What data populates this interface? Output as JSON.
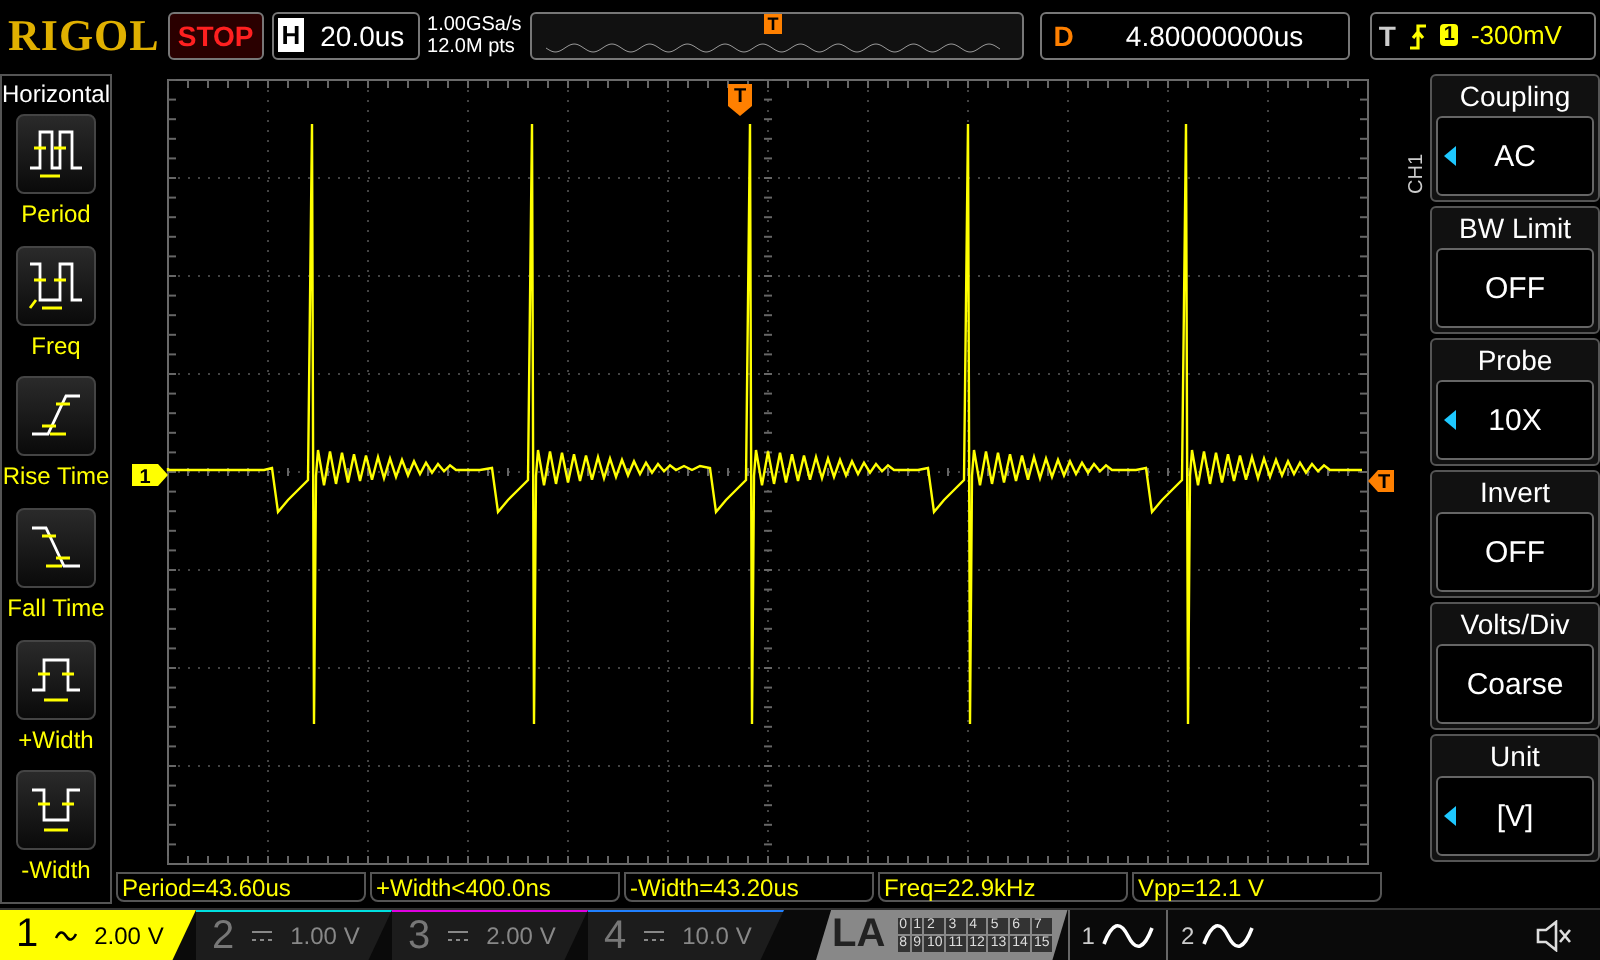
{
  "top_bar": {
    "brand": "RIGOL",
    "run_state": "STOP",
    "horizontal": {
      "label": "H",
      "value": "20.0us"
    },
    "sample_rate": "1.00GSa/s",
    "memory_depth": "12.0M pts",
    "overview_marker": "T",
    "delay": {
      "label": "D",
      "value": "4.80000000us"
    },
    "trigger": {
      "label": "T",
      "source": "1",
      "level": "-300mV"
    }
  },
  "left_menu": {
    "title": "Horizontal",
    "items": [
      {
        "label": "Period",
        "kind": "period"
      },
      {
        "label": "Freq",
        "kind": "freq"
      },
      {
        "label": "Rise Time",
        "kind": "rise"
      },
      {
        "label": "Fall Time",
        "kind": "fall"
      },
      {
        "label": "+Width",
        "kind": "pwidth"
      },
      {
        "label": "-Width",
        "kind": "nwidth"
      }
    ]
  },
  "screen": {
    "channel_marker": "1",
    "trigger_position_marker": "T",
    "trigger_level_marker": "T"
  },
  "right_menu": {
    "channel": "CH1",
    "items": [
      {
        "title": "Coupling",
        "value": "AC",
        "adjustable": true
      },
      {
        "title": "BW Limit",
        "value": "OFF",
        "adjustable": false
      },
      {
        "title": "Probe",
        "value": "10X",
        "adjustable": true
      },
      {
        "title": "Invert",
        "value": "OFF",
        "adjustable": false
      },
      {
        "title": "Volts/Div",
        "value": "Coarse",
        "adjustable": false
      },
      {
        "title": "Unit",
        "value": "[V]",
        "adjustable": true
      }
    ]
  },
  "measurements": [
    "Period=43.60us",
    "+Width<400.0ns",
    "-Width=43.20us",
    "Freq=22.9kHz",
    "Vpp=12.1 V"
  ],
  "channels": [
    {
      "number": "1",
      "kind": "ac",
      "scale": "2.00 V",
      "active": true,
      "color": "#ffff00"
    },
    {
      "number": "2",
      "kind": "dc",
      "scale": "1.00 V",
      "active": false,
      "color": "#00e0e0"
    },
    {
      "number": "3",
      "kind": "dc",
      "scale": "2.00 V",
      "active": false,
      "color": "#e000e0"
    },
    {
      "number": "4",
      "kind": "dc",
      "scale": "10.0 V",
      "active": false,
      "color": "#2080ff"
    }
  ],
  "logic_analyzer": {
    "label": "LA",
    "bits": [
      "0",
      "1",
      "2",
      "3",
      "4",
      "5",
      "6",
      "7",
      "8",
      "9",
      "10",
      "11",
      "12",
      "13",
      "14",
      "15"
    ]
  },
  "generators": [
    "1",
    "2"
  ]
}
